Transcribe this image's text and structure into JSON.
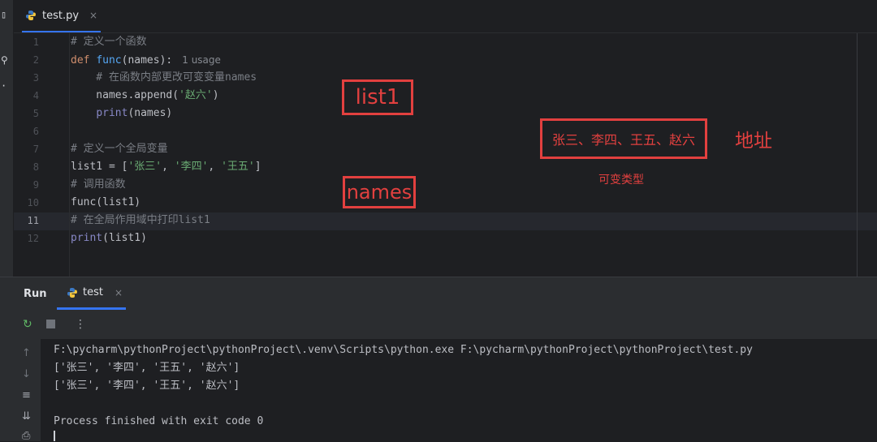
{
  "editor_tab": {
    "filename": "test.py",
    "close": "×"
  },
  "code": [
    {
      "n": "1",
      "parts": [
        {
          "t": "# 定义一个函数",
          "c": "cm"
        }
      ]
    },
    {
      "n": "2",
      "parts": [
        {
          "t": "def ",
          "c": "kw"
        },
        {
          "t": "func",
          "c": "fn"
        },
        {
          "t": "(names):",
          "c": ""
        }
      ],
      "hint": "1 usage"
    },
    {
      "n": "3",
      "parts": [
        {
          "t": "    # 在函数内部更改可变变量names",
          "c": "cm"
        }
      ]
    },
    {
      "n": "4",
      "parts": [
        {
          "t": "    names.append(",
          "c": ""
        },
        {
          "t": "'赵六'",
          "c": "st"
        },
        {
          "t": ")",
          "c": ""
        }
      ]
    },
    {
      "n": "5",
      "parts": [
        {
          "t": "    ",
          "c": ""
        },
        {
          "t": "print",
          "c": "bi"
        },
        {
          "t": "(names)",
          "c": ""
        }
      ]
    },
    {
      "n": "6",
      "parts": []
    },
    {
      "n": "7",
      "parts": [
        {
          "t": "# 定义一个全局变量",
          "c": "cm"
        }
      ]
    },
    {
      "n": "8",
      "parts": [
        {
          "t": "list1 = [",
          "c": ""
        },
        {
          "t": "'张三'",
          "c": "st"
        },
        {
          "t": ", ",
          "c": ""
        },
        {
          "t": "'李四'",
          "c": "st"
        },
        {
          "t": ", ",
          "c": ""
        },
        {
          "t": "'王五'",
          "c": "st"
        },
        {
          "t": "]",
          "c": ""
        }
      ]
    },
    {
      "n": "9",
      "parts": [
        {
          "t": "# 调用函数",
          "c": "cm"
        }
      ]
    },
    {
      "n": "10",
      "parts": [
        {
          "t": "func(list1)",
          "c": ""
        }
      ]
    },
    {
      "n": "11",
      "parts": [
        {
          "t": "# 在全局作用域中打印list1",
          "c": "cm"
        }
      ],
      "active": true
    },
    {
      "n": "12",
      "parts": [
        {
          "t": "print",
          "c": "bi"
        },
        {
          "t": "(list1)",
          "c": ""
        }
      ]
    }
  ],
  "annotations": {
    "list1": "list1",
    "names": "names",
    "values": "张三、李四、王五、赵六",
    "address": "地址",
    "mutable": "可变类型"
  },
  "colors": {
    "annotation": "#e2403f",
    "accent": "#3574f0"
  },
  "run_panel": {
    "title": "Run",
    "tab": "test",
    "tab_close": "×",
    "toolbar_icons": [
      "rerun-icon",
      "stop-icon",
      "more-icon"
    ],
    "side_icons": [
      "up-arrow-icon",
      "down-arrow-icon",
      "soft-wrap-icon",
      "scroll-to-end-icon",
      "print-icon"
    ],
    "output": [
      "F:\\pycharm\\pythonProject\\pythonProject\\.venv\\Scripts\\python.exe F:\\pycharm\\pythonProject\\pythonProject\\test.py",
      "['张三', '李四', '王五', '赵六']",
      "['张三', '李四', '王五', '赵六']",
      "",
      "Process finished with exit code 0"
    ]
  }
}
